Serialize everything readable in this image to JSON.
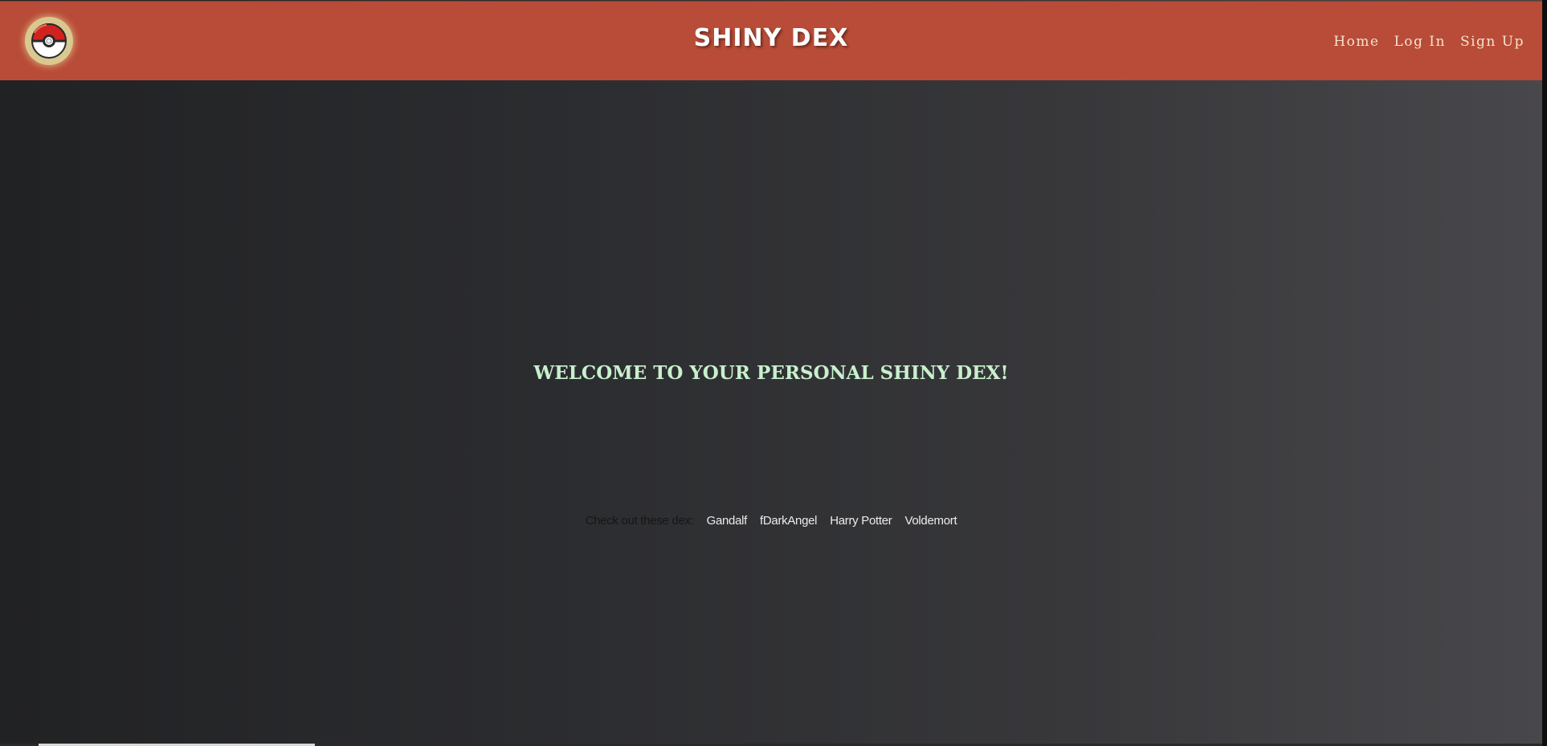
{
  "header": {
    "brand": "SHINY DEX",
    "logo_icon": "pokeball-icon",
    "nav": [
      {
        "label": "Home"
      },
      {
        "label": "Log In"
      },
      {
        "label": "Sign Up"
      }
    ]
  },
  "main": {
    "welcome": "WELCOME TO YOUR PERSONAL SHINY DEX!",
    "dex_label": "Check out these dex:",
    "dex_links": [
      {
        "label": "Gandalf"
      },
      {
        "label": "fDarkAngel"
      },
      {
        "label": "Harry Potter"
      },
      {
        "label": "Voldemort"
      }
    ]
  },
  "colors": {
    "header_bg": "#b84c38",
    "welcome_text": "#c8f0cd",
    "nav_text": "#f6e3cd"
  }
}
